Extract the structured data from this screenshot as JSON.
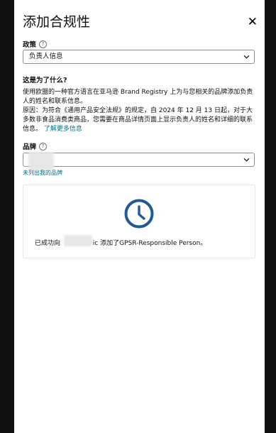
{
  "header": {
    "title": "添加合规性",
    "close_label": "✕"
  },
  "policy": {
    "label": "政策",
    "selected": "负责人信息"
  },
  "info": {
    "title": "这是为了什么?",
    "line1": "使用欧盟的一种官方语言在亚马逊 Brand Registry 上为与您相关的品牌添加负责人的姓名和联系信息。",
    "line2": "原因：为符合《通用产品安全法规》的规定，自 2024 年 12 月 13 日起，对于大多数非食品消费类商品，您需要在商品详情页面上显示负责人的姓名和详细的联系信息。",
    "learn_more": "了解更多信息"
  },
  "brand": {
    "label": "品牌",
    "selected": "",
    "not_listed_link": "未列出我的品牌"
  },
  "status": {
    "text_prefix": "已成功向",
    "text_suffix": "ic 添加了GPSR-Responsible Person。"
  },
  "colors": {
    "accent": "#1f5a96",
    "link": "#007185"
  },
  "icons": {
    "close": "close-icon",
    "help": "help-icon",
    "dropdown": "chevron-down-icon",
    "status": "clock-icon"
  }
}
